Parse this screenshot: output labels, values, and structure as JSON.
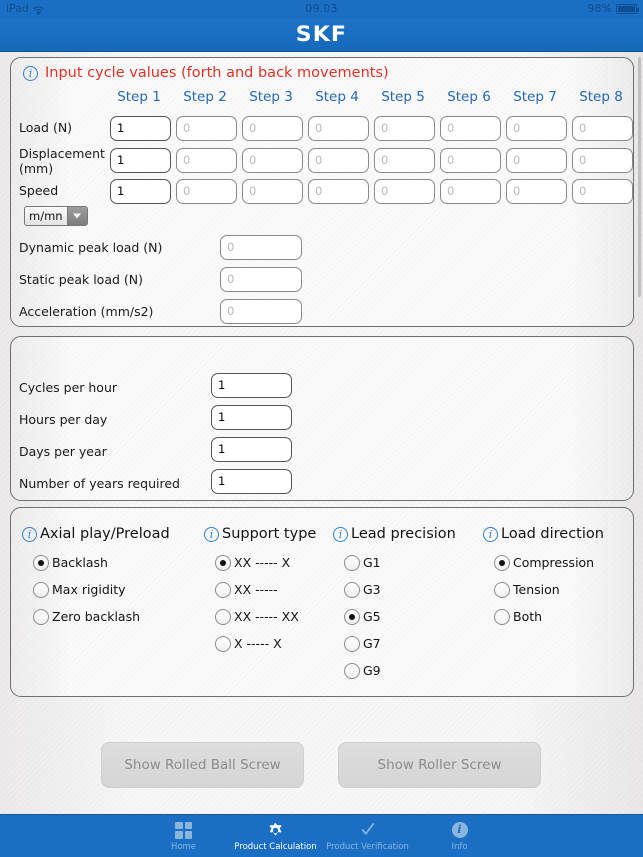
{
  "status_bar": {
    "device": "iPad",
    "wifi_icon": "wifi-icon",
    "time": "09.03",
    "battery_percent": "98%",
    "battery_icon": "battery-icon"
  },
  "navbar": {
    "brand": "SKF"
  },
  "cycle_panel": {
    "info_icon": "info-icon",
    "title": "Input cycle values (forth and back movements)",
    "step_headers": [
      "Step 1",
      "Step 2",
      "Step 3",
      "Step 4",
      "Step 5",
      "Step 6",
      "Step 7",
      "Step 8"
    ],
    "rows": [
      {
        "label": "Load (N)",
        "values": [
          "1",
          "",
          "",
          "",
          "",
          "",
          "",
          ""
        ],
        "placeholders": [
          "0",
          "0",
          "0",
          "0",
          "0",
          "0",
          "0",
          "0"
        ]
      },
      {
        "label": "Displacement (mm)",
        "values": [
          "1",
          "",
          "",
          "",
          "",
          "",
          "",
          ""
        ],
        "placeholders": [
          "0",
          "0",
          "0",
          "0",
          "0",
          "0",
          "0",
          "0"
        ]
      },
      {
        "label": "Speed",
        "values": [
          "1",
          "",
          "",
          "",
          "",
          "",
          "",
          ""
        ],
        "placeholders": [
          "0",
          "0",
          "0",
          "0",
          "0",
          "0",
          "0",
          "0"
        ]
      }
    ],
    "unit_select": {
      "value": "m/mn",
      "arrow_icon": "chevron-down-icon"
    },
    "extra_fields": [
      {
        "label": "Dynamic peak load (N)",
        "value": "",
        "placeholder": "0"
      },
      {
        "label": "Static peak load (N)",
        "value": "",
        "placeholder": "0"
      },
      {
        "label": "Acceleration (mm/s2)",
        "value": "",
        "placeholder": "0"
      }
    ]
  },
  "duty_panel": {
    "fields": [
      {
        "label": "Cycles per hour",
        "value": "1",
        "placeholder": "1"
      },
      {
        "label": "Hours per day",
        "value": "1",
        "placeholder": "1"
      },
      {
        "label": "Days per year",
        "value": "1",
        "placeholder": "1"
      },
      {
        "label": "Number of years required",
        "value": "1",
        "placeholder": "1"
      }
    ]
  },
  "options_panel": {
    "groups": [
      {
        "info_icon": "info-icon",
        "title": "Axial play/Preload",
        "options": [
          {
            "label": "Backlash",
            "selected": true
          },
          {
            "label": "Max rigidity",
            "selected": false
          },
          {
            "label": "Zero backlash",
            "selected": false
          }
        ]
      },
      {
        "info_icon": "info-icon",
        "title": "Support type",
        "options": [
          {
            "label": "XX ----- X",
            "selected": true
          },
          {
            "label": "XX -----",
            "selected": false
          },
          {
            "label": "XX ----- XX",
            "selected": false
          },
          {
            "label": "X ----- X",
            "selected": false
          }
        ]
      },
      {
        "info_icon": "info-icon",
        "title": "Lead precision",
        "options": [
          {
            "label": "G1",
            "selected": false
          },
          {
            "label": "G3",
            "selected": false
          },
          {
            "label": "G5",
            "selected": true
          },
          {
            "label": "G7",
            "selected": false
          },
          {
            "label": "G9",
            "selected": false
          }
        ]
      },
      {
        "info_icon": "info-icon",
        "title": "Load direction",
        "options": [
          {
            "label": "Compression",
            "selected": true
          },
          {
            "label": "Tension",
            "selected": false
          },
          {
            "label": "Both",
            "selected": false
          }
        ]
      }
    ]
  },
  "actions": {
    "ball_screw_label": "Show Rolled Ball Screw",
    "roller_screw_label": "Show Roller Screw"
  },
  "tabbar": {
    "tabs": [
      {
        "label": "Home",
        "icon": "grid-icon",
        "active": false
      },
      {
        "label": "Product Calculation",
        "icon": "gear-icon",
        "active": true
      },
      {
        "label": "Product Verification",
        "icon": "checkmark-icon",
        "active": false
      },
      {
        "label": "Info",
        "icon": "info-icon",
        "active": false
      }
    ]
  },
  "colors": {
    "brand_blue": "#1a6fc4",
    "title_red": "#e03127",
    "step_header_blue": "#2468b5",
    "info_icon_blue": "#2d7fd6"
  }
}
